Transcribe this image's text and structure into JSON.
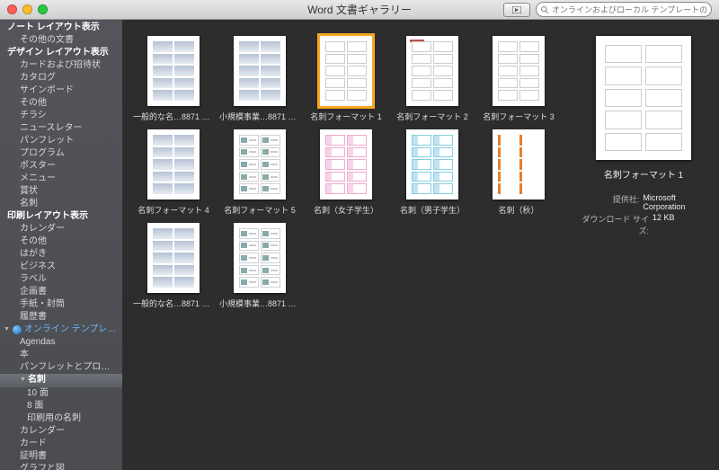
{
  "window": {
    "title": "Word 文書ギャラリー"
  },
  "search": {
    "placeholder": "オンラインおよびローカル テンプレートの検索"
  },
  "sidebar": {
    "items": [
      {
        "label": "ノート レイアウト表示",
        "cls": "sb-head"
      },
      {
        "label": "その他の文書",
        "cls": "ind1"
      },
      {
        "label": "デザイン レイアウト表示",
        "cls": "sb-head"
      },
      {
        "label": "カードおよび招待状",
        "cls": "ind1"
      },
      {
        "label": "カタログ",
        "cls": "ind1"
      },
      {
        "label": "サインボード",
        "cls": "ind1"
      },
      {
        "label": "その他",
        "cls": "ind1"
      },
      {
        "label": "チラシ",
        "cls": "ind1"
      },
      {
        "label": "ニュースレター",
        "cls": "ind1"
      },
      {
        "label": "パンフレット",
        "cls": "ind1"
      },
      {
        "label": "プログラム",
        "cls": "ind1"
      },
      {
        "label": "ポスター",
        "cls": "ind1"
      },
      {
        "label": "メニュー",
        "cls": "ind1"
      },
      {
        "label": "賞状",
        "cls": "ind1"
      },
      {
        "label": "名刺",
        "cls": "ind1"
      },
      {
        "label": "印刷レイアウト表示",
        "cls": "sb-head"
      },
      {
        "label": "カレンダー",
        "cls": "ind1"
      },
      {
        "label": "その他",
        "cls": "ind1"
      },
      {
        "label": "はがき",
        "cls": "ind1"
      },
      {
        "label": "ビジネス",
        "cls": "ind1"
      },
      {
        "label": "ラベル",
        "cls": "ind1"
      },
      {
        "label": "企画書",
        "cls": "ind1"
      },
      {
        "label": "手紙・封筒",
        "cls": "ind1"
      },
      {
        "label": "履歴書",
        "cls": "ind1"
      },
      {
        "label": "オンライン テンプレ…",
        "cls": "online"
      },
      {
        "label": "Agendas",
        "cls": "ind1"
      },
      {
        "label": "本",
        "cls": "ind1"
      },
      {
        "label": "パンフレットとプログラム",
        "cls": "ind1"
      },
      {
        "label": "名刺",
        "cls": "ind1 selected sb-tri"
      },
      {
        "label": "10 面",
        "cls": "ind1",
        "pad": 30
      },
      {
        "label": "8 面",
        "cls": "ind1",
        "pad": 30
      },
      {
        "label": "印刷用の名刺",
        "cls": "ind1",
        "pad": 30
      },
      {
        "label": "カレンダー",
        "cls": "ind1"
      },
      {
        "label": "カード",
        "cls": "ind1"
      },
      {
        "label": "証明書",
        "cls": "ind1"
      },
      {
        "label": "グラフと図",
        "cls": "ind1"
      }
    ]
  },
  "templates": [
    {
      "label": "一般的な名…8871 対応）",
      "style": "shade"
    },
    {
      "label": "小規模事業…8871 対応）",
      "style": "shade"
    },
    {
      "label": "名刺フォーマット 1",
      "style": "blank",
      "selected": true
    },
    {
      "label": "名刺フォーマット 2",
      "style": "hdr"
    },
    {
      "label": "名刺フォーマット 3",
      "style": "blank"
    },
    {
      "label": "名刺フォーマット 4",
      "style": "shade"
    },
    {
      "label": "名刺フォーマット 5",
      "style": "photo"
    },
    {
      "label": "名刺（女子学生）",
      "style": "girl"
    },
    {
      "label": "名刺（男子学生）",
      "style": "boy"
    },
    {
      "label": "名刺（秋）",
      "style": "autumn"
    },
    {
      "label": "一般的な名…8871 対応）",
      "style": "shade"
    },
    {
      "label": "小規模事業…8871 対応）",
      "style": "photo"
    }
  ],
  "preview": {
    "label": "名刺フォーマット 1",
    "provider_k": "提供社:",
    "provider_v": "Microsoft Corporation",
    "size_k": "ダウンロード サイズ:",
    "size_v": "12 KB"
  },
  "colors": {
    "close": "#ff5f57",
    "min": "#ffbd2e",
    "max": "#28c940"
  }
}
